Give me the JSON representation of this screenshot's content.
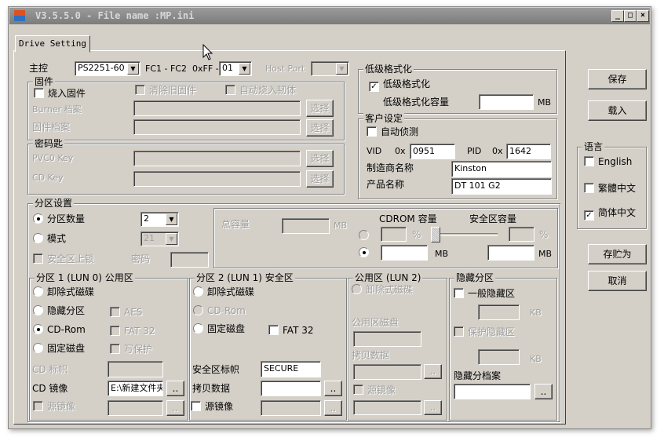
{
  "window": {
    "title": "V3.5.5.0 - File name :MP.ini",
    "minimize": "_",
    "maximize": "□",
    "close": "×"
  },
  "tab": "Drive Setting",
  "controller": {
    "label": "主控",
    "value": "PS2251-60",
    "fc_label": "FC1 - FC2",
    "ff_label": "0xFF -",
    "ff_value": "01",
    "host_port_label": "Host Port",
    "host_port_value": ""
  },
  "firmware": {
    "title": "固件",
    "burn": "烧入固件",
    "burn_checked": false,
    "clear_old": "清除旧固件",
    "auto_burn": "自动烧入韧体",
    "burner_label": "Burner 档案",
    "firmware_label": "固件档案",
    "select": "选择"
  },
  "password": {
    "title": "密码匙",
    "pvc0": "PVC0 Key",
    "cdkey": "CD Key",
    "select": "选择"
  },
  "lowformat": {
    "title": "低级格式化",
    "check": "低级格式化",
    "checked": true,
    "cap_label": "低级格式化容量",
    "cap_value": "",
    "unit": "MB"
  },
  "customer": {
    "title": "客户设定",
    "auto": "自动侦测",
    "auto_checked": false,
    "vid_label": "VID",
    "prefix": "0x",
    "vid": "0951",
    "pid_label": "PID",
    "pid": "1642",
    "vendor_label": "制造商名称",
    "vendor": "Kinston",
    "product_label": "产品名称",
    "product": "DT 101 G2"
  },
  "partition": {
    "title": "分区设置",
    "count_label": "分区数量",
    "count": "2",
    "mode_label": "模式",
    "mode": "21",
    "lock": "安全区上锁",
    "pwd": "密码",
    "total": "总容量",
    "mb": "MB",
    "cdrom_cap": "CDROM 容量",
    "secure_cap": "安全区容量",
    "pct": "%",
    "slider_value": 0
  },
  "p1": {
    "title": "分区 1 (LUN 0) 公用区",
    "removable": "卸除式磁碟",
    "hidden": "隐藏分区",
    "cdrom": "CD-Rom",
    "fixed": "固定磁盘",
    "selected": "CD-Rom",
    "aes": "AES",
    "fat32": "FAT 32",
    "wp": "写保护",
    "cd_label": "CD 标帜",
    "cd_image": "CD 镜像",
    "cd_image_value": "E:\\新建文件夹",
    "src_image": "源镜像",
    "browse": ".."
  },
  "p2": {
    "title": "分区 2 (LUN 1) 安全区",
    "removable": "卸除式磁碟",
    "cdrom": "CD-Rom",
    "fixed": "固定磁盘",
    "fat32": "FAT 32",
    "label": "安全区标帜",
    "label_value": "SECURE",
    "copy": "拷贝数据",
    "src_image": "源镜像",
    "browse": ".."
  },
  "p3": {
    "title": "公用区 (LUN 2)",
    "removable": "卸除式磁碟",
    "disk": "公用区磁盘",
    "copy": "拷贝数据",
    "src_image": "源镜像",
    "browse": ".."
  },
  "hidden": {
    "title": "隐藏分区",
    "normal": "一般隐藏区",
    "kb": "KB",
    "protected": "保护隐藏区",
    "file": "隐藏分档案",
    "browse": ".."
  },
  "buttons": {
    "save": "保存",
    "load": "载入",
    "save_as": "存贮为",
    "cancel": "取消"
  },
  "language": {
    "title": "语言",
    "english": "English",
    "trad": "繁體中文",
    "simp": "简体中文",
    "selected": "简体中文"
  }
}
